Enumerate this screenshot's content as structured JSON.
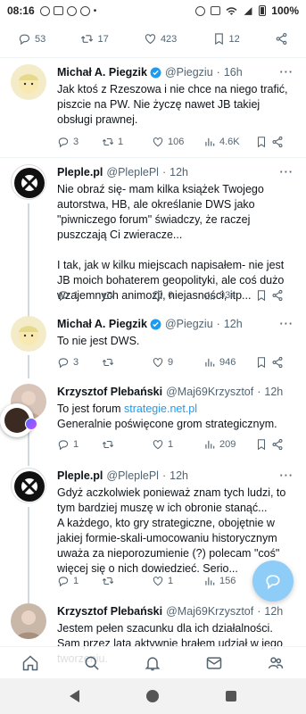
{
  "status_bar": {
    "time": "08:16",
    "battery": "100%"
  },
  "top_actions": {
    "replies": "53",
    "retweets": "17",
    "likes": "423",
    "bookmarks": "12"
  },
  "tweets": [
    {
      "name": "Michał A. Piegzik",
      "handle": "@Piegziu",
      "time": "16h",
      "verified": true,
      "text": [
        "Jak ktoś z Rzeszowa i nie chce na niego trafić, piszcie na PW. Nie życzę nawet JB takiej obsługi prawnej."
      ],
      "replies": "3",
      "retweets": "1",
      "likes": "106",
      "views": "4.6K"
    },
    {
      "name": "Pleple.pl",
      "handle": "@PleplePl",
      "time": "12h",
      "text": [
        "Nie obraź się- mam kilka książek Twojego autorstwa, HB, ale określanie DWS jako \"piwniczego forum\" świadczy, że raczej puszczają Ci zwieracze...",
        "I tak, jak w kilku miejscach napisałem- nie jest JB moich bohaterem geopolityki, ale coś dużo wzajemnych animozji, niejasności, itp..."
      ],
      "replies": "1",
      "retweets": "",
      "likes": "6",
      "views": "934"
    },
    {
      "name": "Michał A. Piegzik",
      "handle": "@Piegziu",
      "time": "12h",
      "verified": true,
      "text": [
        "To nie jest DWS."
      ],
      "replies": "3",
      "retweets": "",
      "likes": "9",
      "views": "946"
    },
    {
      "name": "Krzysztof Plebański",
      "handle": "@Maj69Krzysztof",
      "time": "12h",
      "text_prefix": "To jest forum ",
      "link": "strategie.net.pl",
      "text_rest": "Generalnie poświęcone grom strategicznym.",
      "replies": "1",
      "retweets": "",
      "likes": "1",
      "views": "209"
    },
    {
      "name": "Pleple.pl",
      "handle": "@PleplePl",
      "time": "12h",
      "text": [
        "Gdyż aczkolwiek ponieważ znam tych ludzi, to tym bardziej muszę w ich obronie stanąć...",
        "A każdego, kto gry strategiczne, obojętnie w jakiej formie-skali-umocowaniu historycznym uważa za nieporozumienie (?) polecam \"coś\" więcej się o nich dowiedzieć. Serio..."
      ],
      "replies": "1",
      "retweets": "",
      "likes": "1",
      "views": "156"
    },
    {
      "name": "Krzysztof Plebański",
      "handle": "@Maj69Krzysztof",
      "time": "12h",
      "text": [
        "Jestem pełen szacunku dla ich działalności.",
        "Sam przez lata aktywnie brałem udział w jego tworzeniu."
      ]
    }
  ]
}
